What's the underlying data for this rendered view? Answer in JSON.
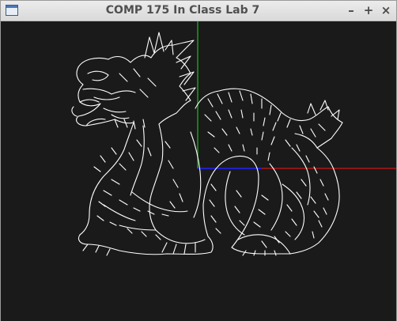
{
  "window": {
    "title": "COMP 175 In Class Lab 7",
    "minimize_glyph": "–",
    "maximize_glyph": "+",
    "close_glyph": "×"
  },
  "icons": {
    "app": "window-app-icon",
    "minimize": "minimize-icon",
    "maximize": "maximize-icon",
    "close": "close-icon"
  },
  "scene": {
    "background_color": "#1a1a1a",
    "model": "dragon-wireframe",
    "model_color": "#ffffff",
    "axes": {
      "x_color": "#d01515",
      "y_color": "#16c016",
      "z_color": "#2020c8"
    }
  }
}
